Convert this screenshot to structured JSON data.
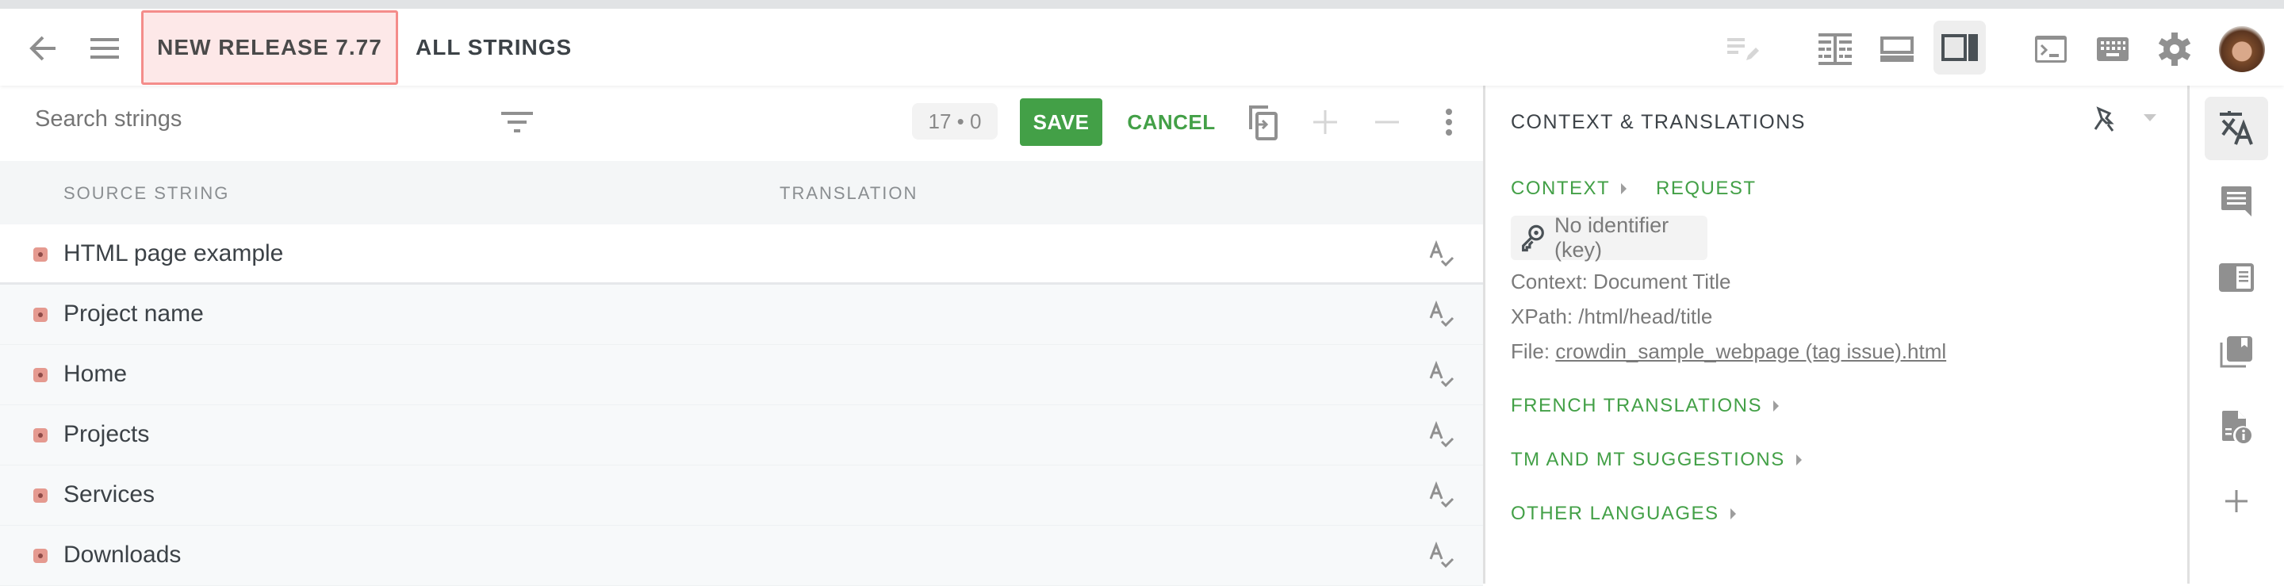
{
  "topbar": {
    "back_icon": "arrow-left-icon",
    "menu_icon": "hamburger-menu-icon",
    "project_badge": "NEW RELEASE 7.77",
    "filter_title": "ALL STRINGS",
    "icons": [
      "edit-lines-icon",
      "side-by-side-layout-icon",
      "bottom-panel-layout-icon",
      "right-panel-layout-icon",
      "terminal-icon",
      "keyboard-icon",
      "settings-gear-icon",
      "user-avatar"
    ],
    "active_layout": "right-panel-layout"
  },
  "toolbar": {
    "search_placeholder": "Search strings",
    "search_value": "",
    "counter": "17 • 0",
    "save_label": "SAVE",
    "cancel_label": "CANCEL"
  },
  "table": {
    "columns": [
      "SOURCE STRING",
      "TRANSLATION"
    ],
    "rows": [
      {
        "source": "HTML page example",
        "translation": "",
        "status": "untranslated",
        "selected": true
      },
      {
        "source": "Project name",
        "translation": "",
        "status": "untranslated",
        "selected": false
      },
      {
        "source": "Home",
        "translation": "",
        "status": "untranslated",
        "selected": false
      },
      {
        "source": "Projects",
        "translation": "",
        "status": "untranslated",
        "selected": false
      },
      {
        "source": "Services",
        "translation": "",
        "status": "untranslated",
        "selected": false
      },
      {
        "source": "Downloads",
        "translation": "",
        "status": "untranslated",
        "selected": false
      }
    ]
  },
  "panel": {
    "title": "CONTEXT & TRANSLATIONS",
    "context_label": "CONTEXT",
    "request_label": "REQUEST",
    "identifier": "No identifier (key)",
    "context_line": "Context: Document Title",
    "xpath_line": "XPath: /html/head/title",
    "file_prefix": "File: ",
    "file_name": "crowdin_sample_webpage (tag issue).html",
    "sections": [
      "FRENCH TRANSLATIONS",
      "TM AND MT SUGGESTIONS",
      "OTHER LANGUAGES"
    ]
  },
  "rail": {
    "icons": [
      "translate-icon",
      "comments-icon",
      "glossary-icon",
      "translation-memory-icon",
      "file-info-icon",
      "add-icon"
    ],
    "active": "translate-icon"
  },
  "colors": {
    "accent_green": "#43a047",
    "badge_bg": "#fde8e8",
    "badge_border": "#f48c8a",
    "untranslated": "#e59a90"
  }
}
